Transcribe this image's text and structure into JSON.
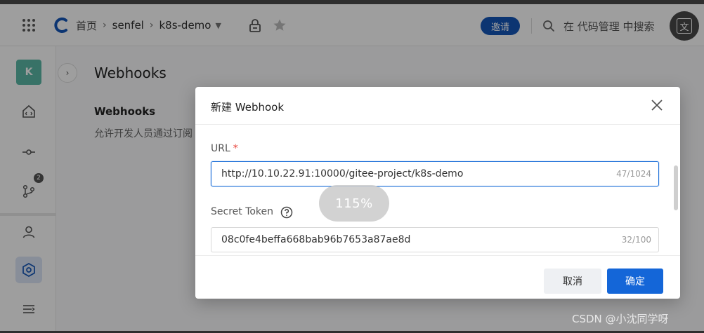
{
  "header": {
    "breadcrumb": {
      "home": "首页",
      "org": "senfel",
      "repo": "k8s-demo"
    },
    "invite_label": "邀请",
    "search_placeholder": "在 代码管理 中搜索",
    "translate_glyph": "文"
  },
  "sidebar": {
    "avatar_letter": "K",
    "pr_badge_count": "2"
  },
  "content": {
    "title": "Webhooks",
    "subtitle": "Webhooks",
    "description": "允许开发人员通过订阅"
  },
  "modal": {
    "title": "新建 Webhook",
    "url_label": "URL",
    "url_required_mark": "*",
    "url_value": "http://10.10.22.91:10000/gitee-project/k8s-demo",
    "url_counter": "47/1024",
    "token_label": "Secret Token",
    "token_value": "08c0fe4beffa668bab96b7653a87ae8d",
    "token_counter": "32/100",
    "cancel_label": "取消",
    "ok_label": "确定"
  },
  "zoom_indicator": "115%",
  "watermark": "CSDN @小沈同学呀",
  "colors": {
    "primary": "#1466d8",
    "invite": "#1456b8",
    "avatar": "#5bb9a6",
    "required": "#e8453c"
  }
}
